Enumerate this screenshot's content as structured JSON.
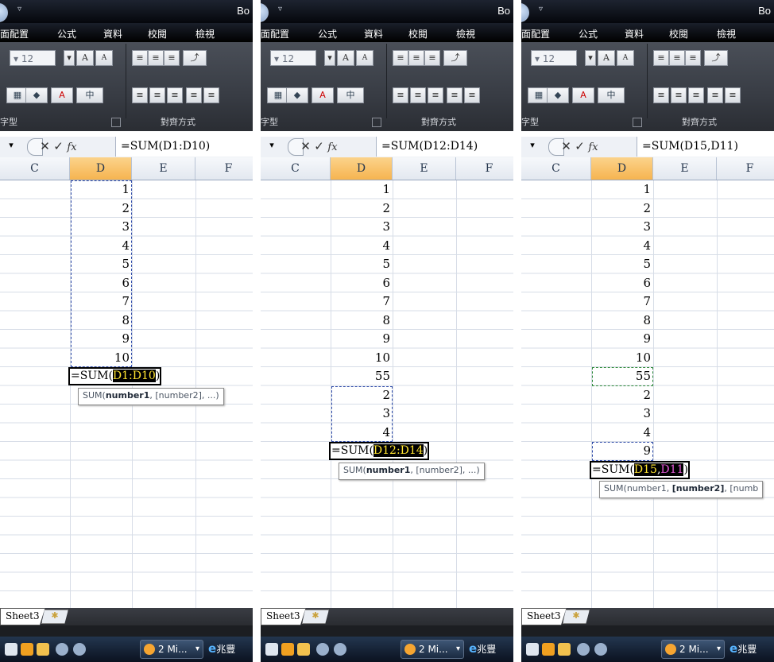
{
  "app": {
    "title_fragment": "Bo",
    "tabs": [
      "面配置",
      "公式",
      "資料",
      "校閱",
      "檢視"
    ],
    "ribbon": {
      "font_size": "12",
      "grow_font": "A",
      "shrink_font": "A",
      "group_font_label": "字型",
      "group_align_label": "對齊方式"
    },
    "formula_bar": {
      "icons": [
        "cancel-icon",
        "enter-icon",
        "insert-function-icon"
      ],
      "fx_label": "fx"
    },
    "columns": [
      "C",
      "D",
      "E",
      "F"
    ],
    "sheet_tab": "Sheet3",
    "taskbar": {
      "window_button": "2 Mi...",
      "ie_fragment": "兆豐"
    },
    "colors": {
      "ribbon_dark": "#383c44",
      "selected_column": "#f6b450",
      "marquee_blue": "#2e4aa8",
      "marquee_green": "#2f8a3a",
      "ref_yellow": "#ffe430",
      "ref_magenta": "#e35ad8"
    }
  },
  "panels": [
    {
      "formula": "=SUM(D1:D10)",
      "values": [
        "1",
        "2",
        "3",
        "4",
        "5",
        "6",
        "7",
        "8",
        "9",
        "10"
      ],
      "edit": {
        "prefix": "=SUM(",
        "ref1": "D1:D10",
        "sep": "",
        "ref2": "",
        "suffix": ")"
      },
      "tooltip": {
        "prefix": "SUM(",
        "bold": "number1",
        "suffix": ", [number2], ...)"
      }
    },
    {
      "formula": "=SUM(D12:D14)",
      "values": [
        "1",
        "2",
        "3",
        "4",
        "5",
        "6",
        "7",
        "8",
        "9",
        "10",
        "55",
        "2",
        "3",
        "4"
      ],
      "edit": {
        "prefix": "=SUM(",
        "ref1": "D12:D14",
        "sep": "",
        "ref2": "",
        "suffix": ")"
      },
      "tooltip": {
        "prefix": "SUM(",
        "bold": "number1",
        "suffix": ", [number2], ...)"
      }
    },
    {
      "formula": "=SUM(D15,D11)",
      "values": [
        "1",
        "2",
        "3",
        "4",
        "5",
        "6",
        "7",
        "8",
        "9",
        "10",
        "55",
        "2",
        "3",
        "4",
        "9"
      ],
      "edit": {
        "prefix": "=SUM(",
        "ref1": "D15",
        "sep": ",",
        "ref2": "D11",
        "suffix": ")"
      },
      "tooltip": {
        "prefix": "SUM(number1, ",
        "bold": "[number2]",
        "suffix": ", [numb"
      }
    }
  ]
}
